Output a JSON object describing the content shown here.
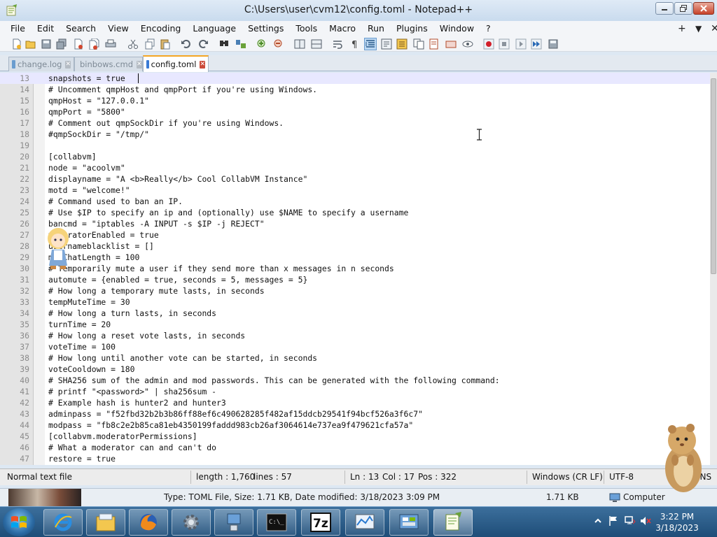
{
  "window": {
    "title": "C:\\Users\\user\\cvm12\\config.toml - Notepad++",
    "controls": {
      "minimize": "minimize",
      "maximize": "maximize",
      "close": "close"
    }
  },
  "menubar": {
    "items": [
      "File",
      "Edit",
      "Search",
      "View",
      "Encoding",
      "Language",
      "Settings",
      "Tools",
      "Macro",
      "Run",
      "Plugins",
      "Window",
      "?"
    ],
    "right": [
      "+",
      "▼",
      "✕"
    ]
  },
  "toolbar": {
    "icons": [
      "new-icon",
      "open-icon",
      "save-icon",
      "save-all-icon",
      "close-icon",
      "close-all-icon",
      "print-icon",
      "cut-icon",
      "copy-icon",
      "paste-icon",
      "undo-icon",
      "redo-icon",
      "find-icon",
      "replace-icon",
      "zoom-in-icon",
      "zoom-out-icon",
      "sync-vertical-icon",
      "sync-horizontal-icon",
      "word-wrap-icon",
      "show-all-chars-icon",
      "indent-guide-icon",
      "udl-icon",
      "doc-map-icon",
      "function-list-icon",
      "folder-workspace-icon",
      "monitoring-icon",
      "record-macro-icon",
      "stop-macro-icon",
      "play-macro-icon",
      "run-macro-multiple-icon",
      "save-macro-icon"
    ]
  },
  "tabs": [
    {
      "label": "change.log",
      "active": false
    },
    {
      "label": "binbows.cmd",
      "active": false
    },
    {
      "label": "config.toml",
      "active": true
    }
  ],
  "editor": {
    "current_line": 13,
    "lines": [
      {
        "n": "13",
        "text": "snapshots = true"
      },
      {
        "n": "14",
        "text": "# Uncomment qmpHost and qmpPort if you're using Windows."
      },
      {
        "n": "15",
        "text": "qmpHost = \"127.0.0.1\""
      },
      {
        "n": "16",
        "text": "qmpPort = \"5800\""
      },
      {
        "n": "17",
        "text": "# Comment out qmpSockDir if you're using Windows."
      },
      {
        "n": "18",
        "text": "#qmpSockDir = \"/tmp/\""
      },
      {
        "n": "19",
        "text": ""
      },
      {
        "n": "20",
        "text": "[collabvm]"
      },
      {
        "n": "21",
        "text": "node = \"acoolvm\""
      },
      {
        "n": "22",
        "text": "displayname = \"A <b>Really</b> Cool CollabVM Instance\""
      },
      {
        "n": "23",
        "text": "motd = \"welcome!\""
      },
      {
        "n": "24",
        "text": "# Command used to ban an IP."
      },
      {
        "n": "25",
        "text": "# Use $IP to specify an ip and (optionally) use $NAME to specify a username"
      },
      {
        "n": "26",
        "text": "bancmd = \"iptables -A INPUT -s $IP -j REJECT\""
      },
      {
        "n": "27",
        "text": "moderatorEnabled = true"
      },
      {
        "n": "28",
        "text": "usernameblacklist = []"
      },
      {
        "n": "29",
        "text": "maxChatLength = 100"
      },
      {
        "n": "30",
        "text": "# Temporarily mute a user if they send more than x messages in n seconds"
      },
      {
        "n": "31",
        "text": "automute = {enabled = true, seconds = 5, messages = 5}"
      },
      {
        "n": "32",
        "text": "# How long a temporary mute lasts, in seconds"
      },
      {
        "n": "33",
        "text": "tempMuteTime = 30"
      },
      {
        "n": "34",
        "text": "# How long a turn lasts, in seconds"
      },
      {
        "n": "35",
        "text": "turnTime = 20"
      },
      {
        "n": "36",
        "text": "# How long a reset vote lasts, in seconds"
      },
      {
        "n": "37",
        "text": "voteTime = 100"
      },
      {
        "n": "38",
        "text": "# How long until another vote can be started, in seconds"
      },
      {
        "n": "39",
        "text": "voteCooldown = 180"
      },
      {
        "n": "40",
        "text": "# SHA256 sum of the admin and mod passwords. This can be generated with the following command:"
      },
      {
        "n": "41",
        "text": "# printf \"<password>\" | sha256sum -"
      },
      {
        "n": "42",
        "text": "# Example hash is hunter2 and hunter3"
      },
      {
        "n": "43",
        "text": "adminpass = \"f52fbd32b2b3b86ff88ef6c490628285f482af15ddcb29541f94bcf526a3f6c7\""
      },
      {
        "n": "44",
        "text": "modpass = \"fb8c2e2b85ca81eb4350199faddd983cb26af3064614e737ea9f479621cfa57a\""
      },
      {
        "n": "45",
        "text": "[collabvm.moderatorPermissions]"
      },
      {
        "n": "46",
        "text": "# What a moderator can and can't do"
      },
      {
        "n": "47",
        "text": "restore = true"
      }
    ]
  },
  "statusbar": {
    "filetype": "Normal text file",
    "length": "length : 1,760",
    "lines": "lines : 57",
    "ln": "Ln : 13",
    "col": "Col : 17",
    "pos": "Pos : 322",
    "eol": "Windows (CR LF)",
    "encoding": "UTF-8",
    "mode": "INS"
  },
  "explorer_strip": {
    "details": "Type: TOML File, Size: 1.71 KB, Date modified: 3/18/2023 3:09 PM",
    "size": "1.71 KB",
    "location": "Computer"
  },
  "taskbar": {
    "buttons": [
      "internet-explorer",
      "file-explorer",
      "firefox",
      "settings",
      "remote-desktop",
      "command-prompt",
      "7-zip",
      "performance-monitor",
      "control-panel",
      "notepad-plus-plus"
    ],
    "active": "notepad-plus-plus",
    "clock": {
      "time": "3:22 PM",
      "date": "3/18/2023"
    }
  },
  "colors": {
    "active_tab_accent": "#f5a623",
    "current_line": "#e8e8ff",
    "gutter": "#e4e4e4",
    "taskbar": "#1e4d78"
  }
}
